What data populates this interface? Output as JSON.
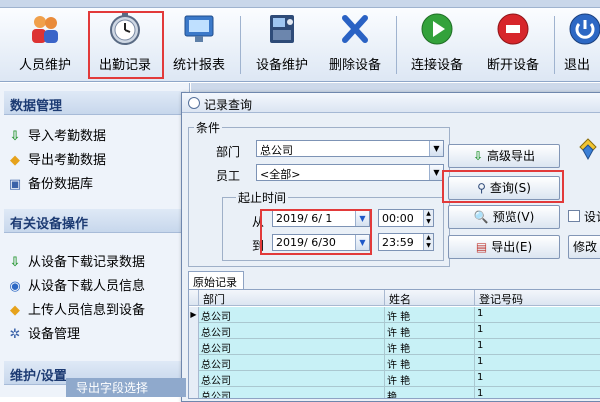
{
  "toolbar": {
    "items": [
      {
        "label": "人员维护",
        "icon": "people-icon"
      },
      {
        "label": "出勤记录",
        "icon": "clock-icon"
      },
      {
        "label": "统计报表",
        "icon": "monitor-icon"
      },
      {
        "label": "设备维护",
        "icon": "device-icon"
      },
      {
        "label": "删除设备",
        "icon": "delete-x-icon"
      },
      {
        "label": "连接设备",
        "icon": "play-icon"
      },
      {
        "label": "断开设备",
        "icon": "stop-icon"
      },
      {
        "label": "退出",
        "icon": "exit-icon"
      }
    ]
  },
  "sidebar": {
    "section_data": "数据管理",
    "data_items": [
      {
        "label": "导入考勤数据",
        "icon": "import-arrow-icon"
      },
      {
        "label": "导出考勤数据",
        "icon": "export-diamond-icon"
      },
      {
        "label": "备份数据库",
        "icon": "backup-icon"
      }
    ],
    "section_device": "有关设备操作",
    "device_items": [
      {
        "label": "从设备下载记录数据",
        "icon": "download-arrow-icon"
      },
      {
        "label": "从设备下载人员信息",
        "icon": "download-circle-icon"
      },
      {
        "label": "上传人员信息到设备",
        "icon": "upload-diamond-icon"
      },
      {
        "label": "设备管理",
        "icon": "gear-icon"
      }
    ],
    "section_maint": "维护/设置",
    "bottom_hint": "导出字段选择"
  },
  "dialog": {
    "title": "记录查询",
    "conditions_label": "条件",
    "dept_label": "部门",
    "dept_value": "总公司",
    "employee_label": "员工",
    "employee_value": "<全部>",
    "time_group_label": "起止时间",
    "from_label": "从",
    "from_date": "2019/ 6/ 1",
    "from_time": "00:00",
    "to_label": "到",
    "to_date": "2019/ 6/30",
    "to_time": "23:59",
    "advanced_export": "高级导出",
    "query": "查询(S)",
    "preview": "预览(V)",
    "export": "导出(E)",
    "settings_partial": "设计",
    "modify_partial": "修改"
  },
  "grid": {
    "tab_label": "原始记录",
    "columns": [
      "部门",
      "姓名",
      "登记号码"
    ],
    "rows": [
      [
        "总公司",
        "许  艳",
        "1"
      ],
      [
        "总公司",
        "许  艳",
        "1"
      ],
      [
        "总公司",
        "许  艳",
        "1"
      ],
      [
        "总公司",
        "许  艳",
        "1"
      ],
      [
        "总公司",
        "许  艳",
        "1"
      ],
      [
        "总公司",
        "   艳",
        "1"
      ]
    ]
  },
  "colors": {
    "highlight_border": "#e23a3a",
    "grid_row_bg": "#c8f1f6",
    "section_text": "#1d3b73"
  }
}
